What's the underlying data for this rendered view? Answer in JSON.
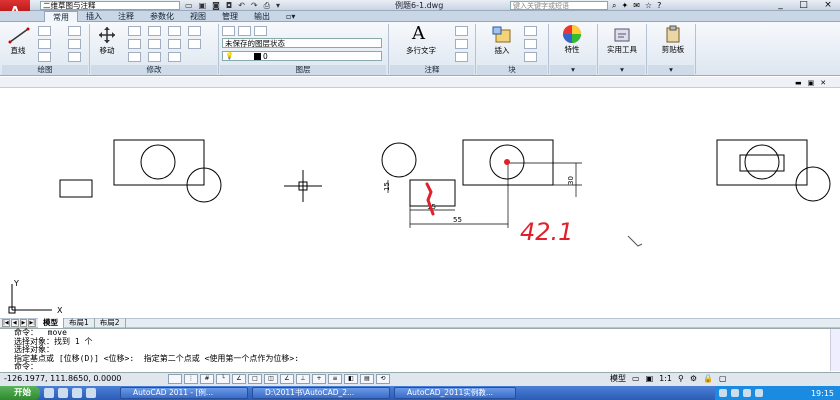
{
  "titlebar": {
    "app_logo": "A",
    "workspace": "二维草图与注释",
    "document_title": "例题6-1.dwg",
    "search_placeholder": "键入关键字或短语",
    "window_controls": [
      "_",
      "□",
      "×"
    ]
  },
  "tabs": [
    "常用",
    "插入",
    "注释",
    "参数化",
    "视图",
    "管理",
    "输出",
    "▫▾"
  ],
  "active_tab": "常用",
  "ribbon": {
    "draw_panel": {
      "line_label": "直线",
      "panel_label": "绘图"
    },
    "modify_panel": {
      "move_label": "移动",
      "panel_label": "修改"
    },
    "layer_panel": {
      "layer_state": "未保存的图层状态",
      "current_layer": "0",
      "panel_label": "图层"
    },
    "annotation_panel": {
      "mtext_label": "多行文字",
      "panel_label": "注释"
    },
    "block_panel": {
      "insert_label": "插入",
      "panel_label": "块"
    },
    "properties_label": "特性",
    "utilities_label": "实用工具",
    "clipboard_label": "剪贴板"
  },
  "drawing": {
    "dimensions": [
      "15",
      "55",
      "30",
      "15"
    ],
    "handwriting": "42.1",
    "ucs_x": "X",
    "ucs_y": "Y"
  },
  "layout_tabs": [
    "模型",
    "布局1",
    "布局2"
  ],
  "active_layout": "模型",
  "command_lines": [
    "命令：  move",
    "选择对象：找到 1 个",
    "选择对象：",
    "指定基点或 [位移(D)] <位移>:  指定第二个点或 <使用第一个点作为位移>:",
    "命令："
  ],
  "status": {
    "coords": "-126.1977, 111.8650, 0.0000",
    "model_label": "模型",
    "scale": "1:1"
  },
  "taskbar": {
    "start_label": "开始",
    "tasks": [
      "AutoCAD 2011 - [例...",
      "D:\\2011书\\AutoCAD_2...",
      "AutoCAD_2011实例教..."
    ],
    "clock": "19:15"
  },
  "colors": {
    "accent_red": "#e0202a",
    "ribbon_blue": "#cfdbe9"
  }
}
